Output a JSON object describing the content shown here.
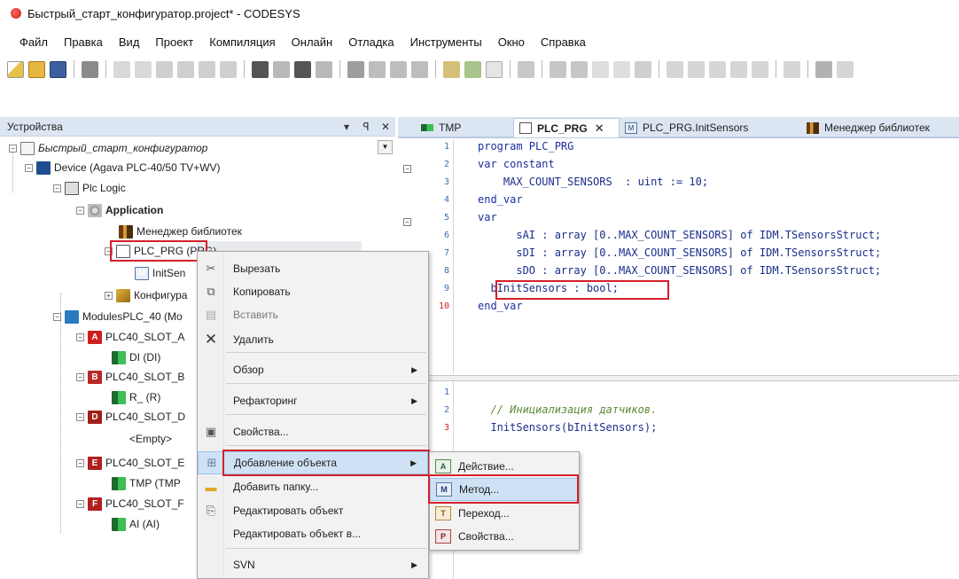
{
  "window": {
    "title": "Быстрый_старт_конфигуратор.project* - CODESYS"
  },
  "menu": [
    "Файл",
    "Правка",
    "Вид",
    "Проект",
    "Компиляция",
    "Онлайн",
    "Отладка",
    "Инструменты",
    "Окно",
    "Справка"
  ],
  "devices_panel": {
    "title": "Устройства",
    "controls": [
      "▾",
      "ꟼ",
      "✕"
    ],
    "tree": [
      {
        "label": "Быстрый_старт_конфигуратор",
        "italic": true
      },
      {
        "label": "Device (Agava PLC-40/50 TV+WV)"
      },
      {
        "label": "Plc Logic"
      },
      {
        "label": "Application",
        "bold": true
      },
      {
        "label": "Менеджер библиотек"
      },
      {
        "label": "PLC_PRG (PRG)"
      },
      {
        "label": "InitSen"
      },
      {
        "label": "Конфигура"
      },
      {
        "label": "ModulesPLC_40 (Mo"
      },
      {
        "label": "PLC40_SLOT_A",
        "slot": "A",
        "color": "#cc1f1f"
      },
      {
        "label": "DI (DI)"
      },
      {
        "label": "PLC40_SLOT_B",
        "slot": "B",
        "color": "#b8292a"
      },
      {
        "label": "R_ (R)"
      },
      {
        "label": "PLC40_SLOT_D",
        "slot": "D",
        "color": "#a0201a"
      },
      {
        "label": "<Empty>"
      },
      {
        "label": "PLC40_SLOT_E",
        "slot": "E",
        "color": "#b02020"
      },
      {
        "label": "TMP (TMP"
      },
      {
        "label": "PLC40_SLOT_F",
        "slot": "F",
        "color": "#b02020"
      },
      {
        "label": "AI (AI)"
      }
    ]
  },
  "context_menu": {
    "items": [
      {
        "label": "Вырезать",
        "icon": "cut-icon"
      },
      {
        "label": "Копировать",
        "icon": "copy-icon"
      },
      {
        "label": "Вставить",
        "icon": "paste-icon",
        "disabled": true
      },
      {
        "label": "Удалить",
        "icon": "delete-icon"
      },
      {
        "label": "Обзор",
        "submenu": true
      },
      {
        "label": "Рефакторинг",
        "submenu": true
      },
      {
        "label": "Свойства...",
        "icon": "properties-icon"
      },
      {
        "label": "Добавление объекта",
        "icon": "add-object-icon",
        "submenu": true,
        "active": true
      },
      {
        "label": "Добавить папку...",
        "icon": "folder-icon"
      },
      {
        "label": "Редактировать объект",
        "icon": "edit-object-icon"
      },
      {
        "label": "Редактировать объект в..."
      },
      {
        "label": "SVN",
        "submenu": true
      }
    ]
  },
  "submenu": {
    "items": [
      {
        "label": "Действие...",
        "icon": "action-icon"
      },
      {
        "label": "Метод...",
        "icon": "method-icon",
        "active": true
      },
      {
        "label": "Переход...",
        "icon": "transition-icon"
      },
      {
        "label": "Свойства...",
        "icon": "property-icon"
      }
    ]
  },
  "editor": {
    "tabs": [
      {
        "label": "TMP"
      },
      {
        "label": "PLC_PRG",
        "active": true
      },
      {
        "label": "PLC_PRG.InitSensors"
      },
      {
        "label": "Менеджер библиотек"
      }
    ],
    "declarations": [
      {
        "n": "1",
        "text": "program PLC_PRG"
      },
      {
        "n": "2",
        "text": "var constant"
      },
      {
        "n": "3",
        "text": "    MAX_COUNT_SENSORS  : uint := 10;"
      },
      {
        "n": "4",
        "text": "end_var"
      },
      {
        "n": "5",
        "text": "var"
      },
      {
        "n": "6",
        "text": "      sAI : array [0..MAX_COUNT_SENSORS] of IDM.TSensorsStruct;"
      },
      {
        "n": "7",
        "text": "      sDI : array [0..MAX_COUNT_SENSORS] of IDM.TSensorsStruct;"
      },
      {
        "n": "8",
        "text": "      sDO : array [0..MAX_COUNT_SENSORS] of IDM.TSensorsStruct;"
      },
      {
        "n": "9",
        "text": "  bInitSensors : bool;"
      },
      {
        "n": "10",
        "text": "end_var"
      }
    ],
    "body": [
      {
        "n": "1",
        "text": ""
      },
      {
        "n": "2",
        "text": "  // Инициализация датчиков."
      },
      {
        "n": "3",
        "text": "  InitSensors(bInitSensors);"
      }
    ]
  }
}
